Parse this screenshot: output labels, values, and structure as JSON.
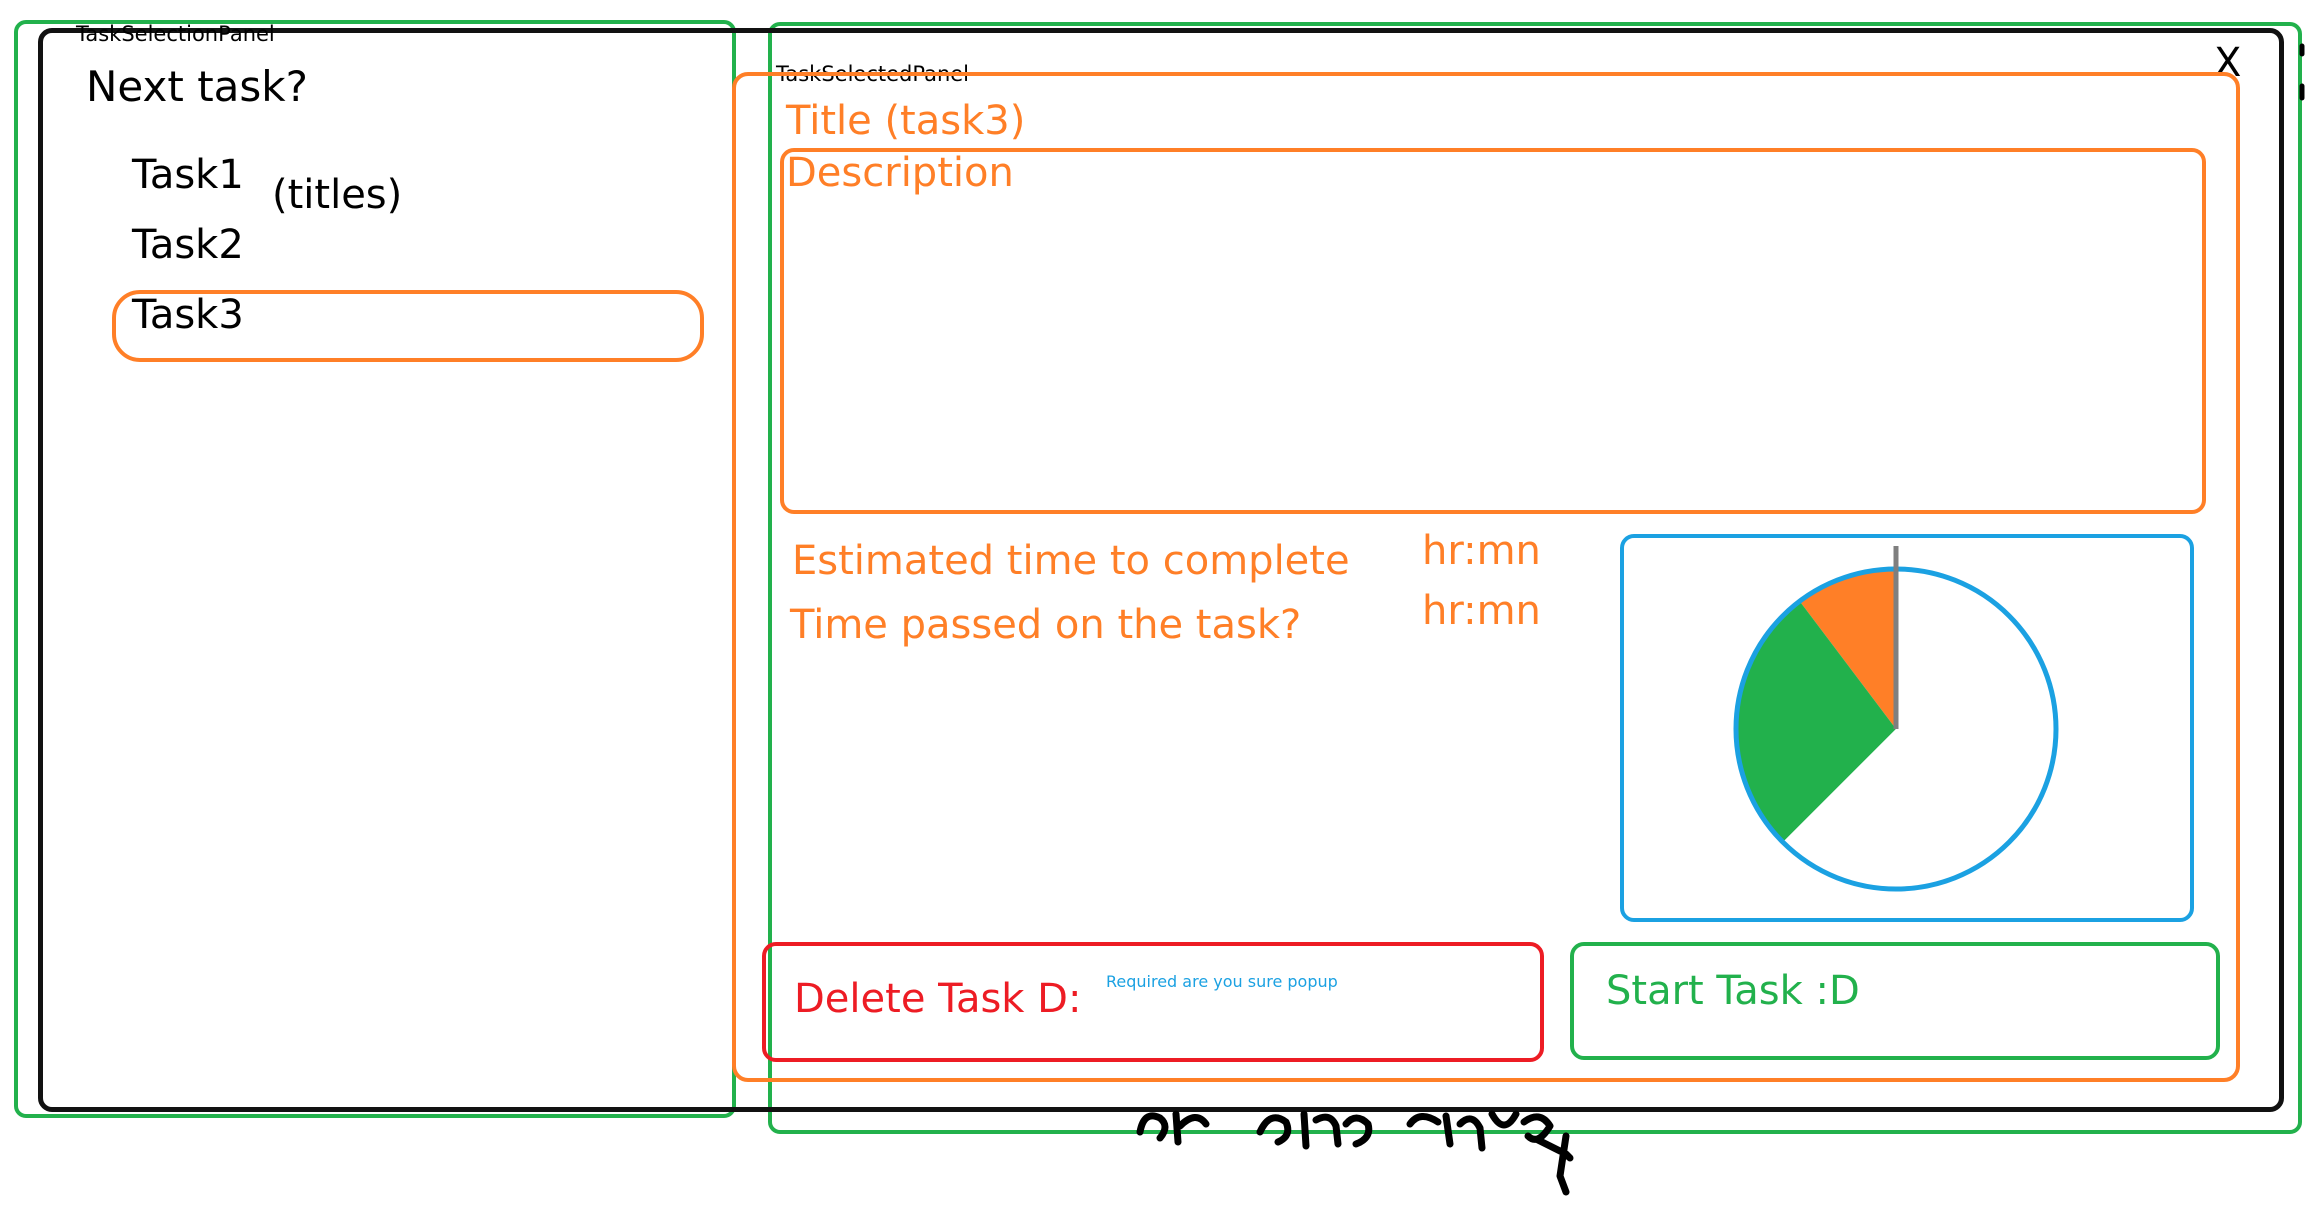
{
  "panels": {
    "selection_panel_label": "TaskSelectionPanel",
    "selected_panel_label": "TaskSelectedPanel"
  },
  "selection": {
    "heading": "Next task?",
    "titles_note": "(titles)",
    "tasks": [
      "Task1",
      "Task2",
      "Task3"
    ],
    "selected_index": 2
  },
  "detail": {
    "close_label": "X",
    "title": "Title (task3)",
    "description_label": "Description",
    "estimated_label": "Estimated time to complete",
    "estimated_value": "hr:mn",
    "passed_label": "Time passed on the task?",
    "passed_value": "hr:mn"
  },
  "chart_data": {
    "type": "pie",
    "slices": [
      {
        "color": "#ff7f27",
        "start_deg": 0,
        "end_deg": -37
      },
      {
        "color": "#22b14c",
        "start_deg": -37,
        "end_deg": -135
      },
      {
        "color": "#ffffff",
        "start_deg": -135,
        "end_deg": -360
      }
    ],
    "outline_color": "#1ba1e2"
  },
  "actions": {
    "delete_label": "Delete Task D:",
    "delete_note": "Required are you sure popup",
    "start_label": "Start Task :D"
  },
  "colors": {
    "accent": "#ff7f27",
    "chart_blue": "#1ba1e2",
    "delete_red": "#ed1c24",
    "start_green": "#22b14c"
  }
}
